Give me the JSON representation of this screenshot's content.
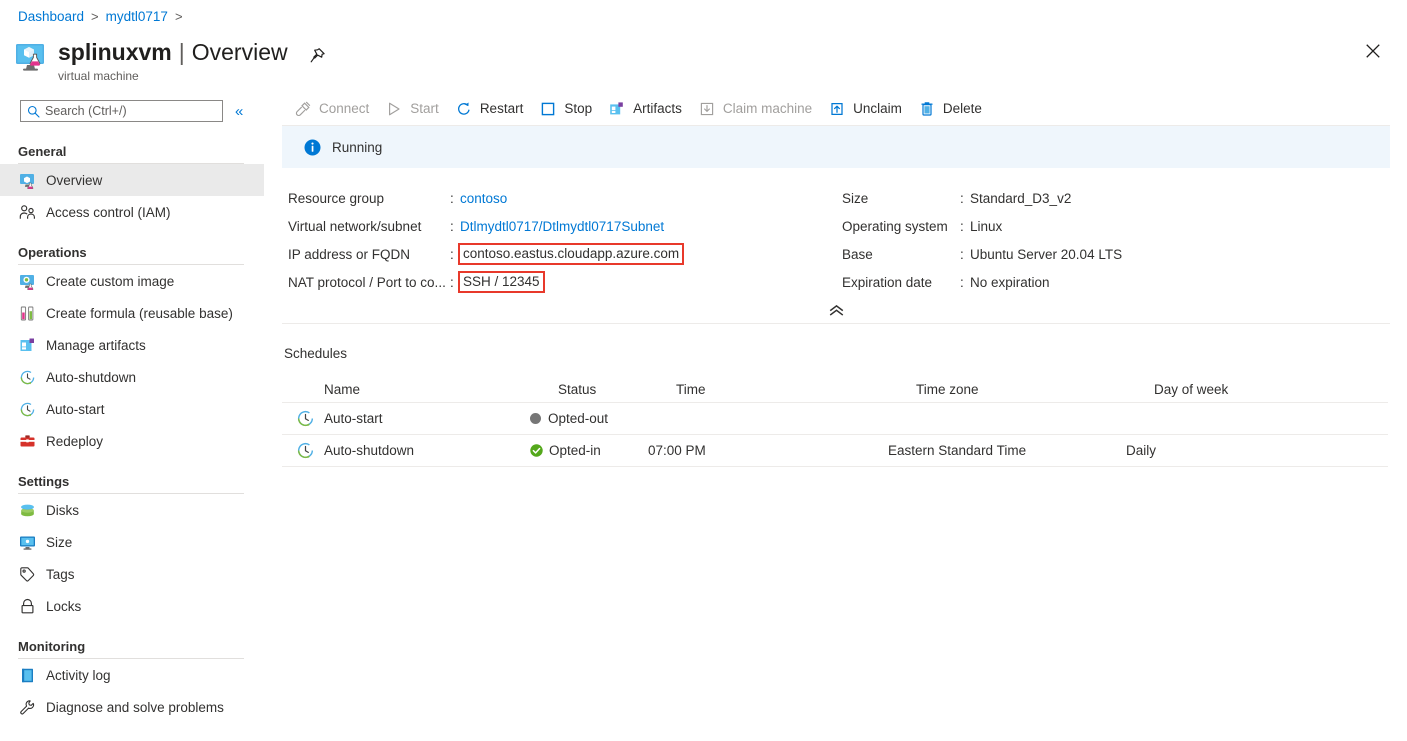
{
  "breadcrumb": {
    "items": [
      {
        "label": "Dashboard"
      },
      {
        "label": "mydtl0717"
      }
    ],
    "separator": ">"
  },
  "header": {
    "resource_name": "splinuxvm",
    "separator": "|",
    "page": "Overview",
    "subtitle": "virtual machine",
    "pin_icon": "pin-icon",
    "close_icon": "close-icon",
    "vm_icon": "devtest-lab-vm-icon"
  },
  "sidebar": {
    "search": {
      "placeholder": "Search (Ctrl+/)",
      "icon": "search-icon"
    },
    "collapse_label": "«",
    "groups": [
      {
        "title": "General",
        "items": [
          {
            "label": "Overview",
            "icon": "vm-icon",
            "selected": true
          },
          {
            "label": "Access control (IAM)",
            "icon": "access-control-icon",
            "selected": false
          }
        ]
      },
      {
        "title": "Operations",
        "items": [
          {
            "label": "Create custom image",
            "icon": "custom-image-icon",
            "selected": false
          },
          {
            "label": "Create formula (reusable base)",
            "icon": "formula-icon",
            "selected": false
          },
          {
            "label": "Manage artifacts",
            "icon": "artifacts-icon",
            "selected": false
          },
          {
            "label": "Auto-shutdown",
            "icon": "clock-icon",
            "selected": false
          },
          {
            "label": "Auto-start",
            "icon": "clock-icon",
            "selected": false
          },
          {
            "label": "Redeploy",
            "icon": "redeploy-icon",
            "selected": false
          }
        ]
      },
      {
        "title": "Settings",
        "items": [
          {
            "label": "Disks",
            "icon": "disks-icon",
            "selected": false
          },
          {
            "label": "Size",
            "icon": "size-icon",
            "selected": false
          },
          {
            "label": "Tags",
            "icon": "tags-icon",
            "selected": false
          },
          {
            "label": "Locks",
            "icon": "lock-icon",
            "selected": false
          }
        ]
      },
      {
        "title": "Monitoring",
        "items": [
          {
            "label": "Activity log",
            "icon": "activity-log-icon",
            "selected": false
          },
          {
            "label": "Diagnose and solve problems",
            "icon": "wrench-icon",
            "selected": false
          }
        ]
      }
    ]
  },
  "toolbar": {
    "commands": [
      {
        "label": "Connect",
        "icon": "connect-plug-icon",
        "disabled": true
      },
      {
        "label": "Start",
        "icon": "play-icon",
        "disabled": true
      },
      {
        "label": "Restart",
        "icon": "restart-icon",
        "disabled": false
      },
      {
        "label": "Stop",
        "icon": "stop-square-icon",
        "disabled": false
      },
      {
        "label": "Artifacts",
        "icon": "artifacts-icon",
        "disabled": false
      },
      {
        "label": "Claim machine",
        "icon": "claim-download-icon",
        "disabled": true
      },
      {
        "label": "Unclaim",
        "icon": "unclaim-upload-icon",
        "disabled": false
      },
      {
        "label": "Delete",
        "icon": "trash-icon",
        "disabled": false
      }
    ]
  },
  "status_banner": {
    "text": "Running",
    "icon": "info-icon",
    "background": "#eff6fc"
  },
  "essentials": {
    "left_properties": [
      {
        "key": "Resource group",
        "value": "contoso",
        "is_link": true,
        "highlighted": false
      },
      {
        "key": "Virtual network/subnet",
        "value": "Dtlmydtl0717/Dtlmydtl0717Subnet",
        "is_link": true,
        "highlighted": false
      },
      {
        "key": "IP address or FQDN",
        "value": "contoso.eastus.cloudapp.azure.com",
        "is_link": false,
        "highlighted": true
      },
      {
        "key": "NAT protocol / Port to co...",
        "value": "SSH / 12345",
        "is_link": false,
        "highlighted": true
      }
    ],
    "right_properties": [
      {
        "key": "Size",
        "value": "Standard_D3_v2",
        "is_link": false,
        "highlighted": false
      },
      {
        "key": "Operating system",
        "value": "Linux",
        "is_link": false,
        "highlighted": false
      },
      {
        "key": "Base",
        "value": "Ubuntu Server 20.04 LTS",
        "is_link": false,
        "highlighted": false
      },
      {
        "key": "Expiration date",
        "value": "No expiration",
        "is_link": false,
        "highlighted": false
      }
    ],
    "colon": ":",
    "collapse_icon": "chevron-double-up-icon",
    "highlight_color": "#e8392b"
  },
  "schedules": {
    "section_title": "Schedules",
    "columns": [
      "Name",
      "Status",
      "Time",
      "Time zone",
      "Day of week"
    ],
    "rows": [
      {
        "name": "Auto-start",
        "icon": "clock-icon",
        "status": "Opted-out",
        "status_icon": "gray-dot-icon",
        "time": "",
        "time_zone": "",
        "day_of_week": ""
      },
      {
        "name": "Auto-shutdown",
        "icon": "clock-icon",
        "status": "Opted-in",
        "status_icon": "green-check-icon",
        "time": "07:00 PM",
        "time_zone": "Eastern Standard Time",
        "day_of_week": "Daily"
      }
    ]
  }
}
